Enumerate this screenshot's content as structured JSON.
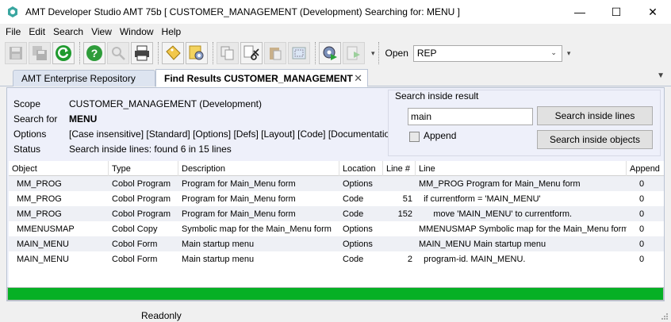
{
  "window": {
    "title": "AMT Developer Studio AMT 75b  [ CUSTOMER_MANAGEMENT (Development) Searching for: MENU ]",
    "controls": {
      "minimize": "—",
      "maximize": "☐",
      "close": "✕"
    }
  },
  "menu": [
    "File",
    "Edit",
    "Search",
    "View",
    "Window",
    "Help"
  ],
  "toolbar": {
    "buttons": [
      "save-icon",
      "save-all-icon",
      "refresh-icon",
      "help-icon",
      "find-icon",
      "print-icon",
      "tag-icon",
      "settings-icon",
      "copy-icon",
      "cut-icon",
      "paste-icon",
      "select-icon",
      "run-icon",
      "export-icon"
    ],
    "open_label": "Open",
    "open_value": "REP"
  },
  "tabs": [
    {
      "label": "AMT Enterprise Repository",
      "active": false
    },
    {
      "label": "Find Results CUSTOMER_MANAGEMENT",
      "active": true
    }
  ],
  "info": {
    "scope_label": "Scope",
    "scope_value": "CUSTOMER_MANAGEMENT (Development)",
    "search_for_label": "Search for",
    "search_for_value": "MENU",
    "options_label": "Options",
    "options_value": "[Case insensitive] [Standard] [Options] [Defs] [Layout] [Code] [Documentatio",
    "status_label": "Status",
    "status_value": "Search inside lines: found 6 in 15 lines"
  },
  "search_inside": {
    "title": "Search inside result",
    "input_value": "main",
    "append_label": "Append",
    "append_checked": false,
    "search_lines_label": "Search inside lines",
    "search_objects_label": "Search inside objects"
  },
  "grid": {
    "columns": [
      "Object",
      "Type",
      "Description",
      "Location",
      "Line #",
      "Line",
      "Append"
    ],
    "rows": [
      [
        "MM_PROG",
        "Cobol Program",
        "Program for Main_Menu form",
        "Options",
        "",
        "MM_PROG Program for Main_Menu form",
        "0"
      ],
      [
        "MM_PROG",
        "Cobol Program",
        "Program for Main_Menu form",
        "Code",
        "51",
        "  if currentform = 'MAIN_MENU'",
        "0"
      ],
      [
        "MM_PROG",
        "Cobol Program",
        "Program for Main_Menu form",
        "Code",
        "152",
        "      move 'MAIN_MENU' to currentform.",
        "0"
      ],
      [
        "MMENUSMAP",
        "Cobol Copy",
        "Symbolic map for the Main_Menu form",
        "Options",
        "",
        "MMENUSMAP Symbolic map for the Main_Menu form",
        "0"
      ],
      [
        "MAIN_MENU",
        "Cobol Form",
        "Main startup menu",
        "Options",
        "",
        "MAIN_MENU Main startup menu",
        "0"
      ],
      [
        "MAIN_MENU",
        "Cobol Form",
        "Main startup menu",
        "Code",
        "2",
        "  program-id. MAIN_MENU.",
        "0"
      ]
    ]
  },
  "progress": {
    "value": 1.0,
    "color": "#06b025"
  },
  "statusbar": {
    "text": "Readonly"
  }
}
